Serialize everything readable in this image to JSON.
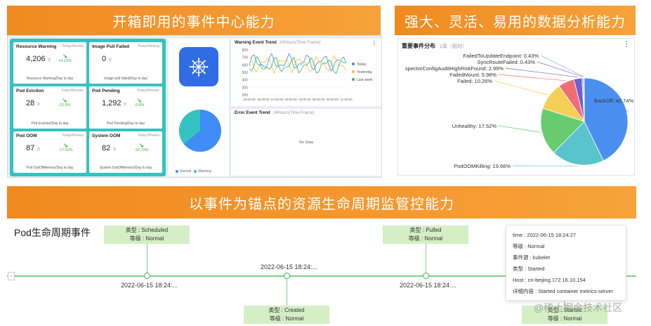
{
  "banners": {
    "b1": "开箱即用的事件中心能力",
    "b2": "强大、灵活、易用的数据分析能力",
    "b3": "以事件为锚点的资源生命周期监管控能力"
  },
  "kpis": [
    {
      "title": "Resource Warning",
      "range": "Today/Weekw",
      "value": "4,206",
      "unit": "次",
      "change": "+4.15%",
      "sub": "Resource Warning/Day to day"
    },
    {
      "title": "Image Pull Failed",
      "range": "Today/Weking",
      "value": "0",
      "unit": "次",
      "change": "",
      "sub": "Image pull failed/Day to day"
    },
    {
      "title": "Pod Eviction",
      "range": "Today/Weeiwe",
      "value": "28",
      "unit": "次",
      "change": "-12.5%",
      "sub": "Pod Eviction/Day to day"
    },
    {
      "title": "Pod Pending",
      "range": "Today/Weeiwe",
      "value": "1,292",
      "unit": "次",
      "change": "-5.8%",
      "sub": "Pod Pending/Day to day"
    },
    {
      "title": "Pod OOM",
      "range": "Today/Weekw",
      "value": "87",
      "unit": "次",
      "change": "-17.92%",
      "sub": "Pod OutOfMemory/Day to day"
    },
    {
      "title": "System OOM",
      "range": "Today/Weekw",
      "value": "82",
      "unit": "次",
      "change": "-26.79%",
      "sub": "System OutOfMemory/Day to day"
    }
  ],
  "mini_pie": {
    "legend": [
      "Normal",
      "Warning"
    ],
    "colors": [
      "#3f8cf5",
      "#35c2c2"
    ]
  },
  "warning_chart": {
    "title": "Warning Event Trend",
    "range": "24Hours(Time Frame)",
    "legend": [
      "Today",
      "Yesterday",
      "Last week"
    ],
    "colors": [
      "#3f8cf5",
      "#f5c23d",
      "#3bb54a"
    ],
    "yticks": [
      "800",
      "700",
      "600",
      "500",
      "400",
      "300",
      "200"
    ],
    "xticks": [
      "15:00:00",
      "18:00:00",
      "21:00:00",
      "00:00:00",
      "03:00:00",
      "06:00:00",
      "09:00:00",
      "11:00:00"
    ]
  },
  "error_chart": {
    "title": "Error Event Trend",
    "range": "24Hours(Time Frame)",
    "empty": "No Data"
  },
  "analysis": {
    "title": "重要事件分布",
    "range": "1周（相对）"
  },
  "chart_data": {
    "type": "pie",
    "title": "重要事件分布",
    "categories": [
      "BackOff",
      "PodOOMKilling",
      "Unhealthy",
      "Failed",
      "FailedMount",
      "InspectorConfigAuditHighRiskFound",
      "SyncRouteFailed",
      "FailedToUpdateEndpoint"
    ],
    "values": [
      42.74,
      19.66,
      17.52,
      10.26,
      5.98,
      2.99,
      0.43,
      0.43
    ],
    "labels": [
      "BackOff: 42.74%",
      "PodOOMKilling: 19.66%",
      "Unhealthy: 17.52%",
      "Failed: 10.26%",
      "FailedMount: 5.98%",
      "spectorConfigAuditHighRiskFound: 2.99%",
      "SyncRouteFailed: 0.43%",
      "FailedToUpdateEndpoint: 0.43%"
    ],
    "colors": [
      "#4a8ff0",
      "#5ac4cc",
      "#66cc6e",
      "#f5cf55",
      "#ee6e73",
      "#6e5fd1",
      "#8a6cd8",
      "#9ab4e8"
    ]
  },
  "timeline": {
    "title": "Pod生命周期事件",
    "events": [
      {
        "type": "类型 : Scheduled",
        "level": "等级 : Normal",
        "date": "2022-06-15 18:24:..."
      },
      {
        "type": "类型 : Created",
        "level": "等级 : Normal",
        "date": "2022-06-15 18:24:..."
      },
      {
        "type": "类型 : Pulled",
        "level": "等级 : Normal",
        "date": "2022-06-15 18:24:..."
      },
      {
        "type": "类型 : Started",
        "level": "等级 : Normal",
        "date": ""
      }
    ],
    "left_arrow": "‹"
  },
  "tooltip": [
    "time : 2022-06-15 18:24:27",
    "等级 : Normal",
    "事件源 : kubelet",
    "类型 : Started",
    "Host : cn-beijing.172.16.10.154",
    "详细内容 : Started container metrics-server"
  ],
  "watermark": "@稀土掘金技术社区"
}
